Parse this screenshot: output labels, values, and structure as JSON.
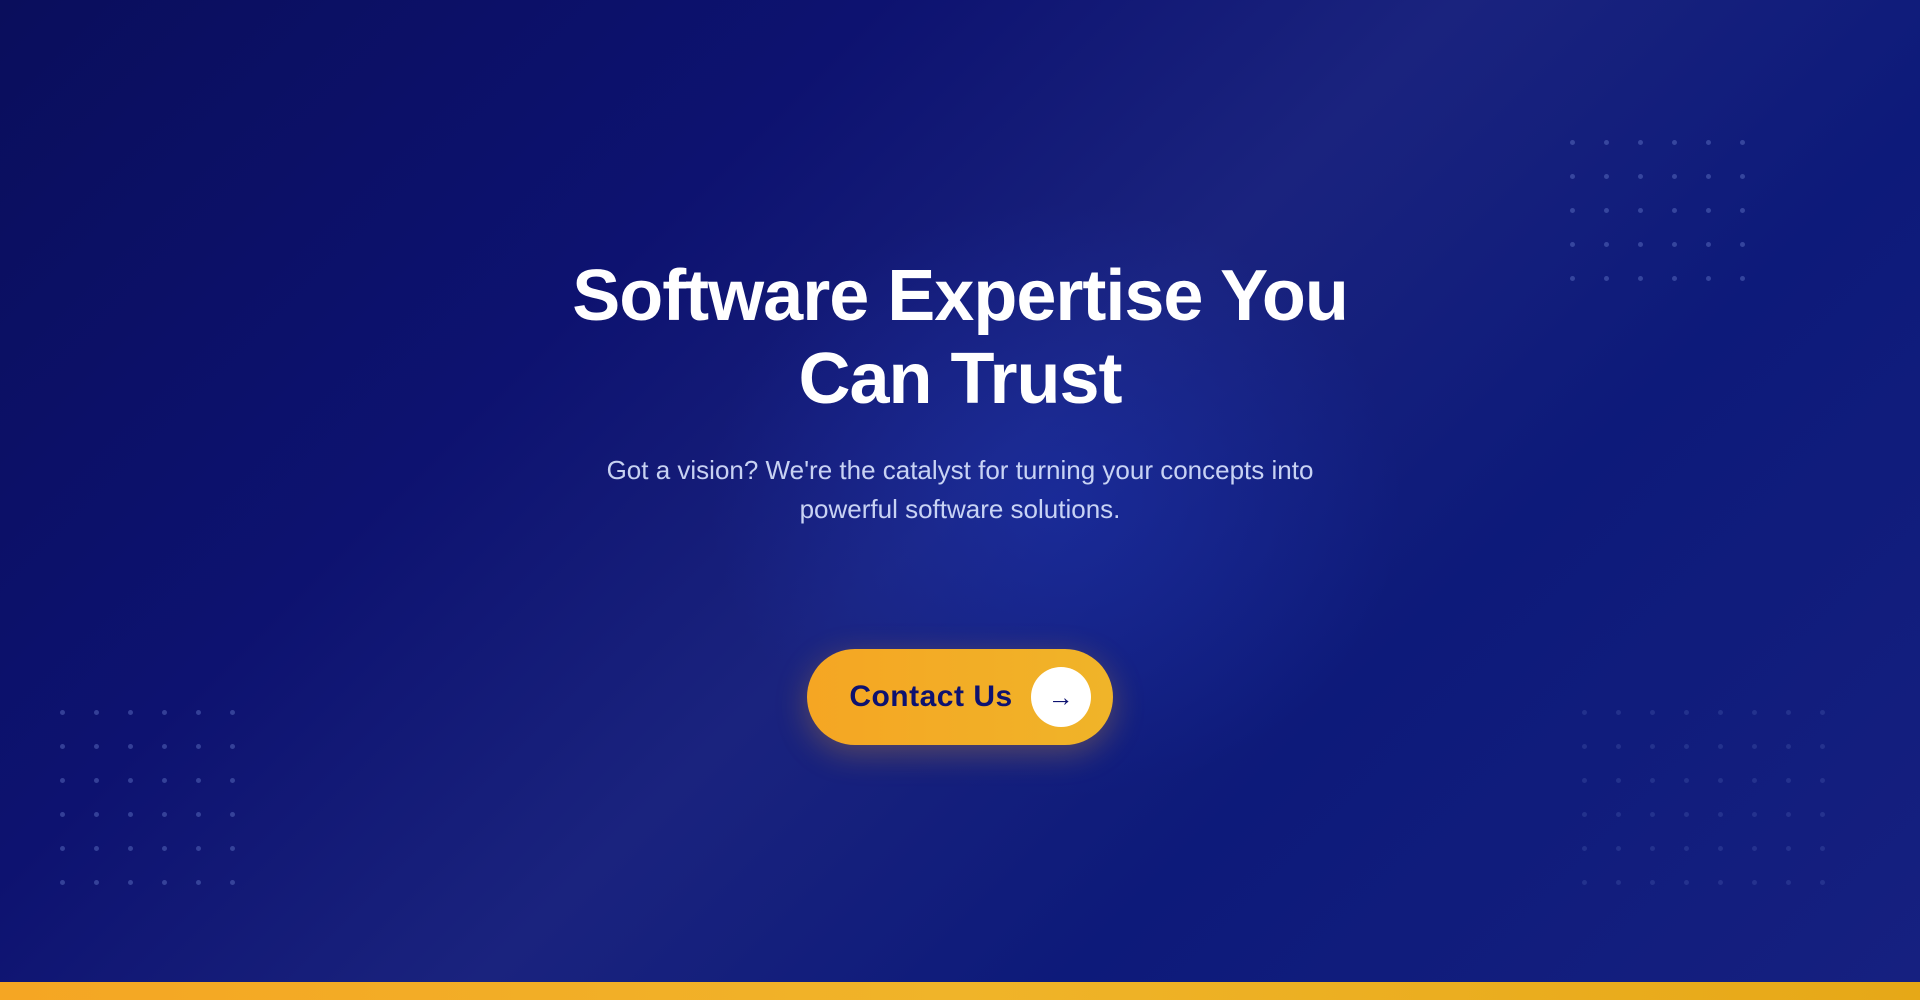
{
  "hero": {
    "title": "Software Expertise You Can Trust",
    "subtitle": "Got a vision? We're the catalyst for turning your concepts into powerful software solutions.",
    "cta_button_label": "Contact Us",
    "cta_arrow": "→",
    "colors": {
      "background_start": "#0a0e5c",
      "background_end": "#162080",
      "gold_bar": "#f5a623",
      "text_white": "#ffffff",
      "text_subtitle": "rgba(220, 230, 255, 0.9)",
      "button_bg": "#f5a623",
      "button_text": "#0d1270"
    }
  }
}
